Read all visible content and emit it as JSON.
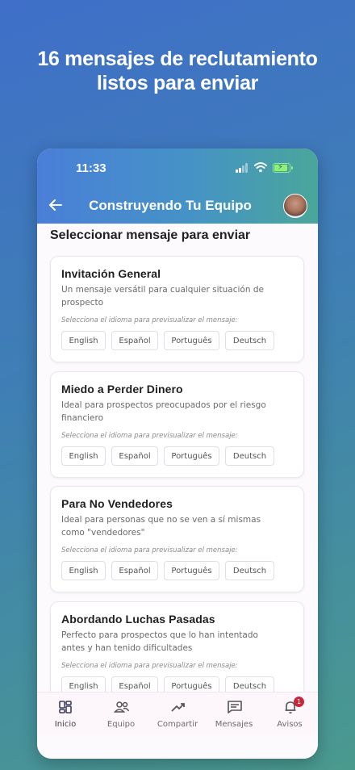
{
  "headline": {
    "line1": "16 mensajes de reclutamiento",
    "line2": "listos para enviar"
  },
  "status_bar": {
    "time": "11:33"
  },
  "app_bar": {
    "title": "Construyendo Tu Equipo",
    "back_icon": "arrow-left-icon",
    "avatar_icon": "user-avatar"
  },
  "section_title": "Seleccionar mensaje para enviar",
  "cards": [
    {
      "title": "Invitación General",
      "description": "Un mensaje versátil para cualquier situación de prospecto",
      "hint": "Selecciona el idioma para previsualizar el mensaje:",
      "languages": [
        "English",
        "Español",
        "Português",
        "Deutsch"
      ]
    },
    {
      "title": "Miedo a Perder Dinero",
      "description": "Ideal para prospectos preocupados por el riesgo financiero",
      "hint": "Selecciona el idioma para previsualizar el mensaje:",
      "languages": [
        "English",
        "Español",
        "Português",
        "Deutsch"
      ]
    },
    {
      "title": "Para No Vendedores",
      "description": "Ideal para personas que no se ven a sí mismas como \"vendedores\"",
      "hint": "Selecciona el idioma para previsualizar el mensaje:",
      "languages": [
        "English",
        "Español",
        "Português",
        "Deutsch"
      ]
    },
    {
      "title": "Abordando Luchas Pasadas",
      "description": "Perfecto para prospectos que lo han intentado antes y han tenido dificultades",
      "hint": "Selecciona el idioma para previsualizar el mensaje:",
      "languages": [
        "English",
        "Español",
        "Português",
        "Deutsch"
      ]
    }
  ],
  "tabs": [
    {
      "label": "Inicio",
      "icon": "dashboard-icon",
      "active": true
    },
    {
      "label": "Equipo",
      "icon": "people-icon",
      "active": false
    },
    {
      "label": "Compartir",
      "icon": "trending-up-icon",
      "active": false
    },
    {
      "label": "Mensajes",
      "icon": "message-icon",
      "active": false
    },
    {
      "label": "Avisos",
      "icon": "bell-icon",
      "active": false,
      "badge": "1"
    }
  ],
  "colors": {
    "background_gradient": [
      "#3f6fc9",
      "#4a9a8e"
    ],
    "app_bar_gradient": [
      "#4a7fd8",
      "#4aa69a"
    ],
    "badge": "#c4283a"
  }
}
